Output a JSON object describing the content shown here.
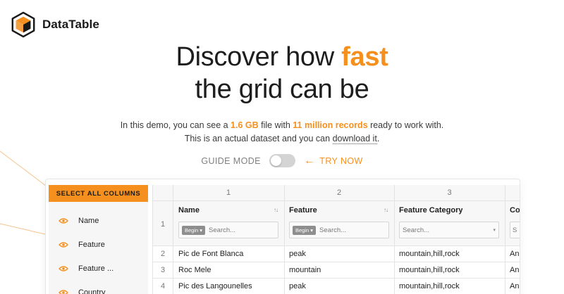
{
  "brand": {
    "name": "DataTable",
    "accent": "#f5901e"
  },
  "hero": {
    "line1_prefix": "Discover how ",
    "line1_accent": "fast",
    "line2": "the grid can be",
    "sub_pre": "In this demo, you can see a ",
    "sub_size": "1.6 GB",
    "sub_mid": " file with ",
    "sub_records": "11 million records",
    "sub_post": " ready to work with.",
    "sub2_pre": "This is an actual dataset and you can ",
    "sub2_link": "download it",
    "sub2_post": "."
  },
  "guide": {
    "label": "GUIDE MODE",
    "toggle_on": false,
    "try_label": "TRY NOW",
    "arrow_icon": "arrow-left-icon"
  },
  "sidebar": {
    "select_all_label": "SELECT ALL COLUMNS",
    "items": [
      {
        "label": "Name",
        "icon": "eye-icon"
      },
      {
        "label": "Feature",
        "icon": "eye-icon"
      },
      {
        "label": "Feature ...",
        "icon": "eye-icon"
      },
      {
        "label": "Country",
        "icon": "eye-icon"
      }
    ]
  },
  "grid": {
    "col_numbers": [
      "1",
      "2",
      "3"
    ],
    "headers": [
      "Name",
      "Feature",
      "Feature Category",
      "Co"
    ],
    "filters": [
      {
        "mode": "Begin",
        "placeholder": "Search..."
      },
      {
        "mode": "Begin",
        "placeholder": "Search..."
      },
      {
        "mode": "",
        "placeholder": "Search..."
      },
      {
        "mode": "",
        "placeholder": "S"
      }
    ],
    "header_row_number": "1",
    "rows": [
      {
        "num": "2",
        "cells": [
          "Pic de Font Blanca",
          "peak",
          "mountain,hill,rock",
          "An"
        ]
      },
      {
        "num": "3",
        "cells": [
          "Roc Mele",
          "mountain",
          "mountain,hill,rock",
          "An"
        ]
      },
      {
        "num": "4",
        "cells": [
          "Pic des Langounelles",
          "peak",
          "mountain,hill,rock",
          "An"
        ]
      }
    ]
  }
}
